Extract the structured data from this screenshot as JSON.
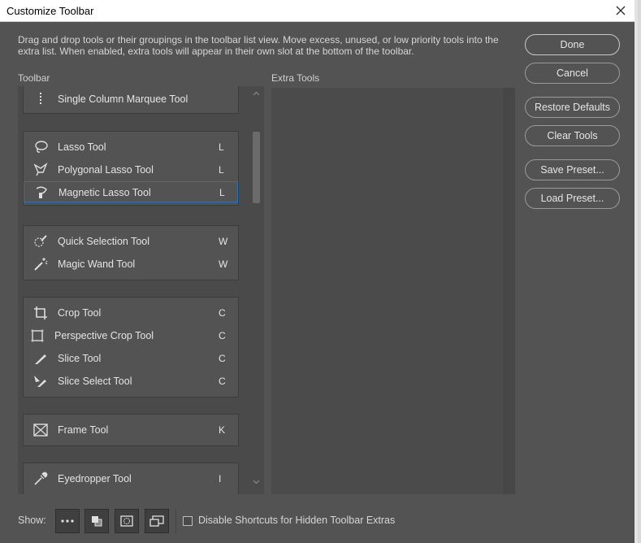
{
  "window": {
    "title": "Customize Toolbar"
  },
  "description": "Drag and drop tools or their groupings in the toolbar list view. Move excess, unused, or low priority tools into the extra list. When enabled, extra tools will appear in their own slot at the bottom of the toolbar.",
  "columns": {
    "toolbar": "Toolbar",
    "extra": "Extra Tools"
  },
  "groups": [
    {
      "tools": [
        {
          "name": "Single Column Marquee Tool",
          "key": "",
          "icon": "single-column-marquee-icon"
        }
      ]
    },
    {
      "tools": [
        {
          "name": "Lasso Tool",
          "key": "L",
          "icon": "lasso-icon"
        },
        {
          "name": "Polygonal Lasso Tool",
          "key": "L",
          "icon": "polygonal-lasso-icon"
        },
        {
          "name": "Magnetic Lasso Tool",
          "key": "L",
          "icon": "magnetic-lasso-icon",
          "selected": true
        }
      ]
    },
    {
      "tools": [
        {
          "name": "Quick Selection Tool",
          "key": "W",
          "icon": "quick-selection-icon"
        },
        {
          "name": "Magic Wand Tool",
          "key": "W",
          "icon": "magic-wand-icon"
        }
      ]
    },
    {
      "tools": [
        {
          "name": "Crop Tool",
          "key": "C",
          "icon": "crop-icon"
        },
        {
          "name": "Perspective Crop Tool",
          "key": "C",
          "icon": "perspective-crop-icon"
        },
        {
          "name": "Slice Tool",
          "key": "C",
          "icon": "slice-icon"
        },
        {
          "name": "Slice Select Tool",
          "key": "C",
          "icon": "slice-select-icon"
        }
      ]
    },
    {
      "tools": [
        {
          "name": "Frame Tool",
          "key": "K",
          "icon": "frame-icon"
        }
      ]
    },
    {
      "tools": [
        {
          "name": "Eyedropper Tool",
          "key": "I",
          "icon": "eyedropper-icon"
        }
      ]
    }
  ],
  "buttons": {
    "done": "Done",
    "cancel": "Cancel",
    "restore": "Restore Defaults",
    "clear": "Clear Tools",
    "save": "Save Preset...",
    "load": "Load Preset..."
  },
  "footer": {
    "show_label": "Show:",
    "show_buttons": [
      "more-icon",
      "foreground-background-icon",
      "quick-mask-icon",
      "screen-mode-icon"
    ],
    "checkbox_label": "Disable Shortcuts for Hidden Toolbar Extras",
    "checkbox_checked": false
  },
  "colors": {
    "panel": "#535353",
    "list": "#4a4a4a",
    "text": "#e4e4e4",
    "selected_border": "#2f6fb3"
  }
}
